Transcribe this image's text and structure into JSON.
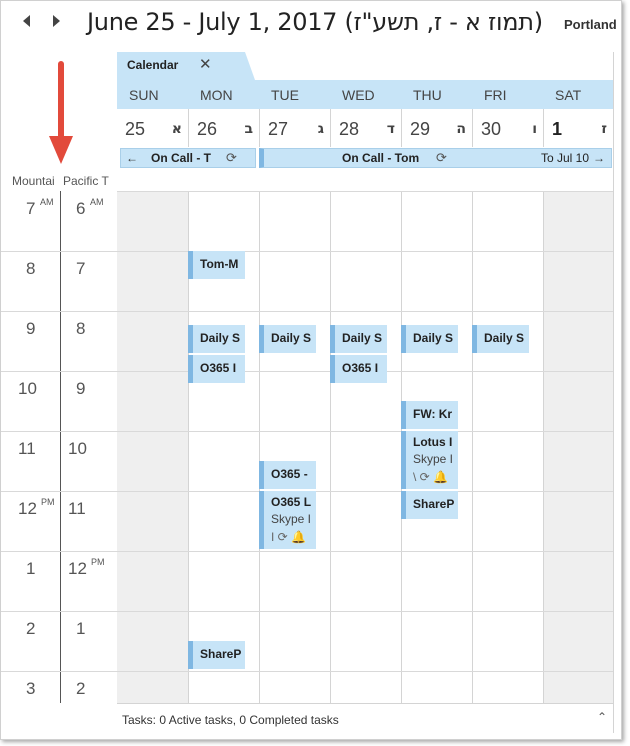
{
  "header": {
    "range_title": "June 25 - July 1, 2017 (תמוז א - ז, תשע\"ז)",
    "weather_location": "Portland"
  },
  "tab": {
    "label": "Calendar",
    "close_glyph": "✕"
  },
  "days": [
    {
      "name": "SUN",
      "num": "25",
      "heb": "א"
    },
    {
      "name": "MON",
      "num": "26",
      "heb": "ב"
    },
    {
      "name": "TUE",
      "num": "27",
      "heb": "ג"
    },
    {
      "name": "WED",
      "num": "28",
      "heb": "ד"
    },
    {
      "name": "THU",
      "num": "29",
      "heb": "ה"
    },
    {
      "name": "FRI",
      "num": "30",
      "heb": "ו"
    },
    {
      "name": "SAT",
      "num": "1",
      "heb": "ז"
    }
  ],
  "allday": {
    "event1": "On Call - T",
    "event2": "On Call - Tom",
    "event2_until": "To Jul 10",
    "left_arrow": "←",
    "right_arrow": "→",
    "recur_glyph": "⟳"
  },
  "timezones": {
    "tz1_label": "Mountai",
    "tz2_label": "Pacific T",
    "tz1_hours": [
      {
        "h": "7",
        "sfx": "AM"
      },
      {
        "h": "8",
        "sfx": ""
      },
      {
        "h": "9",
        "sfx": ""
      },
      {
        "h": "10",
        "sfx": ""
      },
      {
        "h": "11",
        "sfx": ""
      },
      {
        "h": "12",
        "sfx": "PM"
      },
      {
        "h": "1",
        "sfx": ""
      },
      {
        "h": "2",
        "sfx": ""
      },
      {
        "h": "3",
        "sfx": ""
      }
    ],
    "tz2_hours": [
      {
        "h": "6",
        "sfx": "AM"
      },
      {
        "h": "7",
        "sfx": ""
      },
      {
        "h": "8",
        "sfx": ""
      },
      {
        "h": "9",
        "sfx": ""
      },
      {
        "h": "10",
        "sfx": ""
      },
      {
        "h": "11",
        "sfx": ""
      },
      {
        "h": "12",
        "sfx": "PM"
      },
      {
        "h": "1",
        "sfx": ""
      },
      {
        "h": "2",
        "sfx": ""
      }
    ]
  },
  "appointments": {
    "mon_tom": "Tom-M",
    "mon_daily": "Daily S",
    "mon_o365": "O365 I",
    "mon_share": "ShareP",
    "tue_daily": "Daily S",
    "tue_o365a": "O365 -",
    "tue_o365b": "O365 L",
    "tue_o365b_loc": "Skype I",
    "tue_o365b_icons": "I ⟳ 🔔",
    "wed_daily": "Daily S",
    "wed_o365": "O365 I",
    "thu_daily": "Daily S",
    "thu_fw": "FW: Kr",
    "thu_lotus": "Lotus I",
    "thu_lotus_loc": "Skype I",
    "thu_lotus_icons": "\\ ⟳ 🔔",
    "thu_share": "ShareP",
    "fri_daily": "Daily S"
  },
  "status": {
    "text": "Tasks: 0 Active tasks, 0 Completed tasks",
    "chevron": "⌃"
  },
  "colors": {
    "accent_blue": "#c7e4f7",
    "appt_bar": "#7fb7e2",
    "weekend_gray": "#efefef",
    "annotation_red": "#e24a3b"
  }
}
